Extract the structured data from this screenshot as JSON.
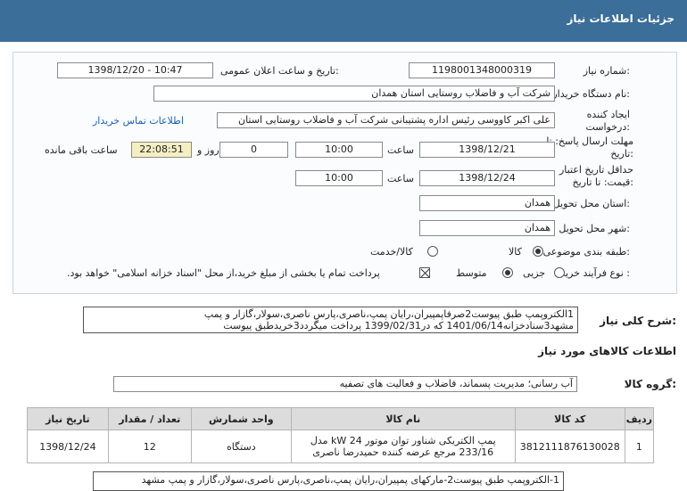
{
  "header": {
    "title": "جزئیات اطلاعات نیاز"
  },
  "fields": {
    "need_number_label": "شماره نیاز:",
    "need_number": "1198001348000319",
    "announce_label": "تاریخ و ساعت اعلان عمومی:",
    "announce_value": "1398/12/20 - 10:47",
    "buyer_label": "نام دستگاه خریدار:",
    "buyer_value": "شرکت آب و فاضلاب روستایی استان همدان",
    "creator_label": "ایجاد کننده درخواست:",
    "creator_value": "علی اکبر کاووسی رئیس اداره پشتیبانی شرکت آب و فاضلاب روستایی استان",
    "contact_link": "اطلاعات تماس خریدار",
    "deadline_label": "مهلت ارسال پاسخ: تا تاریخ:",
    "deadline_date": "1398/12/21",
    "time_label": "ساعت",
    "deadline_time": "10:00",
    "days_value": "0",
    "days_label": "روز و",
    "remaining_time": "22:08:51",
    "remaining_label": "ساعت باقی مانده",
    "validity_label": "حداقل تاریخ اعتبار قیمت: تا تاریخ:",
    "validity_date": "1398/12/24",
    "validity_time": "10:00",
    "province_label": "استان محل تحویل:",
    "province_value": "همدان",
    "city_label": "شهر محل تحویل:",
    "city_value": "همدان",
    "category_label": "طبقه بندی موضوعی:",
    "category_options": [
      "کالا",
      "کالا/خدمت"
    ],
    "process_label": "نوع فرآیند خرید :",
    "process_options": [
      "جزیی",
      "متوسط"
    ],
    "payment_note": "پرداخت تمام یا بخشی از مبلغ خرید،از محل \"اسناد خزانه اسلامی\" خواهد بود."
  },
  "description": {
    "label": "شرح کلی نیاز:",
    "text": "1الکتروپمپ طبق پیوست2صرفاپمپیران،رایان پمپ،ناصری،پارس ناصری،سولار،گازار و پمپ مشهد3سنادخزانه1401/06/14 که در1399/02/31 پرداخت میگردد3خریدطبق پیوست"
  },
  "goods_section": {
    "title": "اطلاعات کالاهای مورد نیاز"
  },
  "goods_group": {
    "label": "گروه کالا:",
    "value": "آب رسانی؛ مدیریت پسماند، فاضلاب و فعالیت های تصفیه"
  },
  "table": {
    "headers": [
      "ردیف",
      "کد کالا",
      "نام کالا",
      "واحد شمارش",
      "تعداد / مقدار",
      "تاریخ نیاز"
    ],
    "rows": [
      [
        "1",
        "3812111876130028",
        "پمپ الکتریکی شناور توان موتور kW 24 مدل 233/16 مرجع عرضه کننده حمیدرضا ناصری",
        "دستگاه",
        "12",
        "1398/12/24"
      ]
    ]
  },
  "footer_note": "1-الکتروپمپ طبق پیوست2-مارکهای پمپیران،رایان پمپ،ناصری،پارس ناصری،سولار،گازار و پمپ مشهد"
}
